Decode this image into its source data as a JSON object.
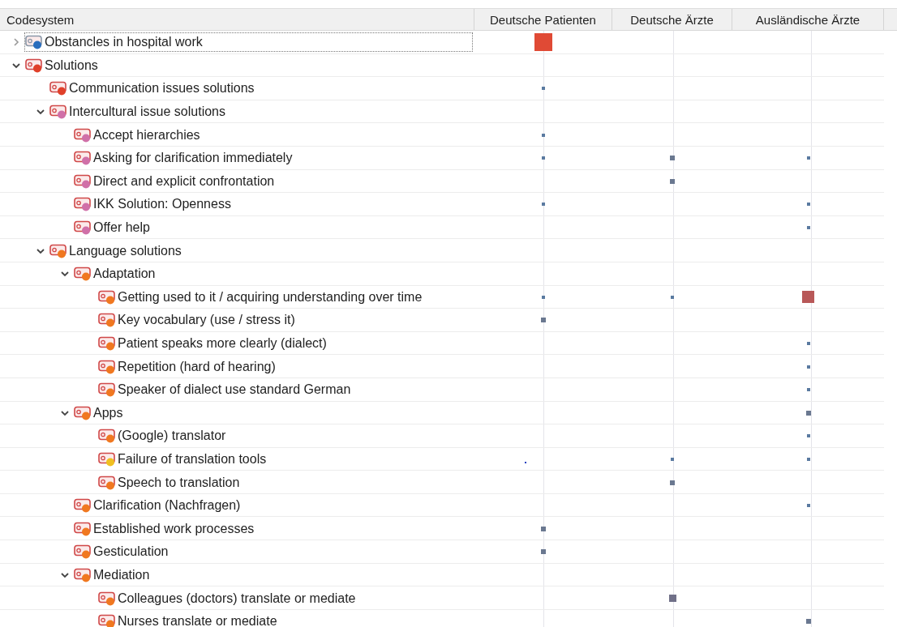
{
  "columns": [
    "Codesystem",
    "Deutsche Patienten",
    "Deutsche Ärzte",
    "Ausländische Ärzte"
  ],
  "codes": [
    {
      "label": "Obstancles in hospital work",
      "color": "#2a6ebd",
      "expanded": false,
      "selected": true,
      "cells": [
        {
          "kind": "large"
        },
        {
          "kind": "none"
        },
        {
          "kind": "none"
        }
      ]
    },
    {
      "label": "Solutions",
      "color": "#e0402a",
      "expanded": true,
      "selected": false,
      "cells": [
        {
          "kind": "none"
        },
        {
          "kind": "none"
        },
        {
          "kind": "none"
        }
      ],
      "children": [
        {
          "label": "Communication issues solutions",
          "color": "#e0402a",
          "selected": false,
          "cells": [
            {
              "kind": "tiny"
            },
            {
              "kind": "none"
            },
            {
              "kind": "none"
            }
          ]
        },
        {
          "label": "Intercultural issue solutions",
          "color": "#d070a8",
          "expanded": true,
          "selected": false,
          "cells": [
            {
              "kind": "none"
            },
            {
              "kind": "none"
            },
            {
              "kind": "none"
            }
          ],
          "children": [
            {
              "label": "Accept hierarchies",
              "color": "#d070a8",
              "selected": false,
              "cells": [
                {
                  "kind": "tiny"
                },
                {
                  "kind": "none"
                },
                {
                  "kind": "none"
                }
              ]
            },
            {
              "label": "Asking for clarification immediately",
              "color": "#d070a8",
              "selected": false,
              "cells": [
                {
                  "kind": "tiny"
                },
                {
                  "kind": "small"
                },
                {
                  "kind": "tiny"
                }
              ]
            },
            {
              "label": "Direct and explicit confrontation",
              "color": "#d070a8",
              "selected": false,
              "cells": [
                {
                  "kind": "none"
                },
                {
                  "kind": "small"
                },
                {
                  "kind": "none"
                }
              ]
            },
            {
              "label": "IKK Solution: Openness",
              "color": "#d070a8",
              "selected": false,
              "cells": [
                {
                  "kind": "tiny"
                },
                {
                  "kind": "none"
                },
                {
                  "kind": "tiny"
                }
              ]
            },
            {
              "label": "Offer help",
              "color": "#d070a8",
              "selected": false,
              "cells": [
                {
                  "kind": "none"
                },
                {
                  "kind": "none"
                },
                {
                  "kind": "tiny"
                }
              ]
            }
          ]
        },
        {
          "label": "Language solutions",
          "color": "#f07820",
          "expanded": true,
          "selected": false,
          "cells": [
            {
              "kind": "none"
            },
            {
              "kind": "none"
            },
            {
              "kind": "none"
            }
          ],
          "children": [
            {
              "label": "Adaptation",
              "color": "#f07820",
              "expanded": true,
              "selected": false,
              "cells": [
                {
                  "kind": "none"
                },
                {
                  "kind": "none"
                },
                {
                  "kind": "none"
                }
              ],
              "children": [
                {
                  "label": "Getting used to it / acquiring understanding over time",
                  "color": "#f07820",
                  "selected": false,
                  "cells": [
                    {
                      "kind": "tiny"
                    },
                    {
                      "kind": "tiny"
                    },
                    {
                      "kind": "medium"
                    }
                  ]
                },
                {
                  "label": "Key vocabulary (use / stress it)",
                  "color": "#f07820",
                  "selected": false,
                  "cells": [
                    {
                      "kind": "small"
                    },
                    {
                      "kind": "none"
                    },
                    {
                      "kind": "none"
                    }
                  ]
                },
                {
                  "label": "Patient speaks more clearly (dialect)",
                  "color": "#f07820",
                  "selected": false,
                  "cells": [
                    {
                      "kind": "none"
                    },
                    {
                      "kind": "none"
                    },
                    {
                      "kind": "tiny"
                    }
                  ]
                },
                {
                  "label": "Repetition (hard of hearing)",
                  "color": "#f07820",
                  "selected": false,
                  "cells": [
                    {
                      "kind": "none"
                    },
                    {
                      "kind": "none"
                    },
                    {
                      "kind": "tiny"
                    }
                  ]
                },
                {
                  "label": "Speaker of dialect use standard German",
                  "color": "#f07820",
                  "selected": false,
                  "cells": [
                    {
                      "kind": "none"
                    },
                    {
                      "kind": "none"
                    },
                    {
                      "kind": "tiny"
                    }
                  ]
                }
              ]
            },
            {
              "label": "Apps",
              "color": "#f07820",
              "expanded": true,
              "selected": false,
              "cells": [
                {
                  "kind": "none"
                },
                {
                  "kind": "none"
                },
                {
                  "kind": "small"
                }
              ],
              "children": [
                {
                  "label": "(Google) translator",
                  "color": "#f07820",
                  "selected": false,
                  "cells": [
                    {
                      "kind": "none"
                    },
                    {
                      "kind": "none"
                    },
                    {
                      "kind": "tiny"
                    }
                  ]
                },
                {
                  "label": "Failure of translation tools",
                  "color": "#f0c020",
                  "selected": false,
                  "cells": [
                    {
                      "kind": "dot"
                    },
                    {
                      "kind": "tiny"
                    },
                    {
                      "kind": "tiny"
                    }
                  ]
                },
                {
                  "label": "Speech to translation",
                  "color": "#f07820",
                  "selected": false,
                  "cells": [
                    {
                      "kind": "none"
                    },
                    {
                      "kind": "small"
                    },
                    {
                      "kind": "none"
                    }
                  ]
                }
              ]
            },
            {
              "label": "Clarification (Nachfragen)",
              "color": "#f07820",
              "selected": false,
              "cells": [
                {
                  "kind": "none"
                },
                {
                  "kind": "none"
                },
                {
                  "kind": "tiny"
                }
              ]
            },
            {
              "label": "Established work processes",
              "color": "#f07820",
              "selected": false,
              "cells": [
                {
                  "kind": "small"
                },
                {
                  "kind": "none"
                },
                {
                  "kind": "none"
                }
              ]
            },
            {
              "label": "Gesticulation",
              "color": "#f07820",
              "selected": false,
              "cells": [
                {
                  "kind": "small"
                },
                {
                  "kind": "none"
                },
                {
                  "kind": "none"
                }
              ]
            },
            {
              "label": "Mediation",
              "color": "#f07820",
              "expanded": true,
              "selected": false,
              "cells": [
                {
                  "kind": "none"
                },
                {
                  "kind": "none"
                },
                {
                  "kind": "none"
                }
              ],
              "children": [
                {
                  "label": "Colleagues (doctors) translate or mediate",
                  "color": "#f07820",
                  "selected": false,
                  "cells": [
                    {
                      "kind": "none"
                    },
                    {
                      "kind": "mediumgrey"
                    },
                    {
                      "kind": "none"
                    }
                  ]
                },
                {
                  "label": "Nurses translate or mediate",
                  "color": "#f07820",
                  "selected": false,
                  "cells": [
                    {
                      "kind": "none"
                    },
                    {
                      "kind": "none"
                    },
                    {
                      "kind": "small"
                    }
                  ]
                }
              ]
            }
          ]
        }
      ]
    }
  ]
}
